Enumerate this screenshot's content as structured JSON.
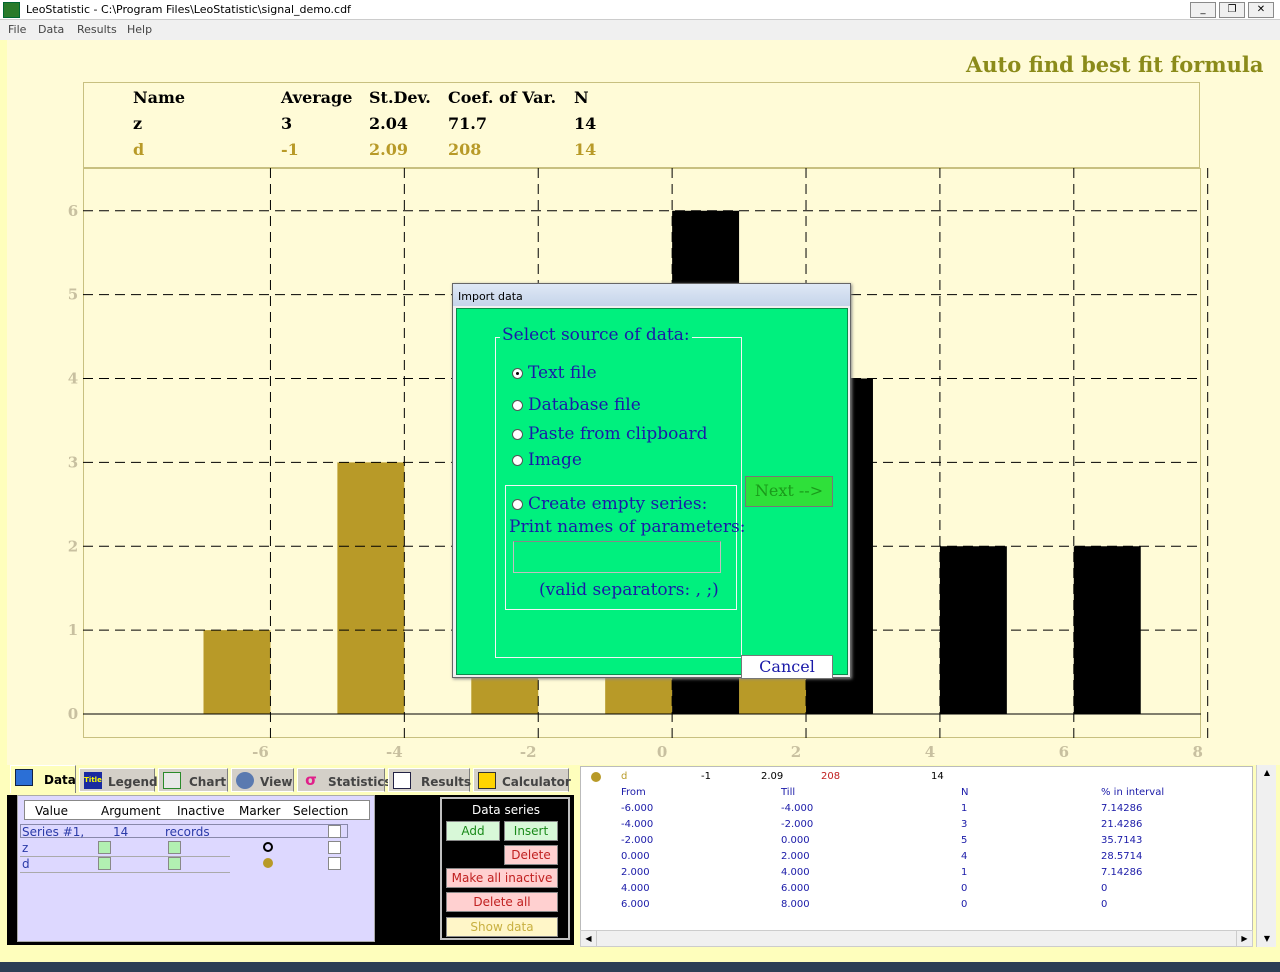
{
  "window": {
    "title": "LeoStatistic - C:\\Program Files\\LeoStatistic\\signal_demo.cdf",
    "minimize": "_",
    "restore": "❐",
    "close": "✕"
  },
  "menu": [
    "File",
    "Data",
    "Results",
    "Help"
  ],
  "fit_link": "Auto find best fit formula",
  "stats_table": {
    "headers": [
      "Name",
      "Average",
      "St.Dev.",
      "Coef. of Var.",
      "N"
    ],
    "rows": [
      {
        "name": "z",
        "average": "3",
        "stdev": "2.04",
        "coef": "71.7",
        "n": "14",
        "color": "#000000"
      },
      {
        "name": "d",
        "average": "-1",
        "stdev": "2.09",
        "coef": "208",
        "n": "14",
        "color": "#b89a28"
      }
    ]
  },
  "chart_data": {
    "type": "bar",
    "xlim": [
      -7.8,
      8.9
    ],
    "ylim": [
      0,
      6.2
    ],
    "x_ticks": [
      "-6",
      "-4",
      "-2",
      "0",
      "2",
      "4",
      "6",
      "8"
    ],
    "y_ticks": [
      "0",
      "1",
      "2",
      "3",
      "4",
      "5",
      "6"
    ],
    "grid": true,
    "series": [
      {
        "name": "d",
        "color": "#b89a28",
        "bins": [
          [
            -6,
            -4
          ],
          [
            -4,
            -2
          ],
          [
            -2,
            0
          ],
          [
            0,
            2
          ],
          [
            2,
            4
          ],
          [
            4,
            6
          ],
          [
            6,
            8
          ]
        ],
        "values": [
          1,
          3,
          5,
          4,
          1,
          0,
          0
        ]
      },
      {
        "name": "z",
        "color": "#000000",
        "bins": [
          [
            -6,
            -4
          ],
          [
            -4,
            -2
          ],
          [
            -2,
            0
          ],
          [
            0,
            2
          ],
          [
            2,
            4
          ],
          [
            4,
            6
          ],
          [
            6,
            8
          ]
        ],
        "values": [
          0,
          0,
          0,
          6,
          4,
          2,
          2
        ]
      }
    ]
  },
  "dialog": {
    "title": "Import data",
    "group_label": "Select source of data:",
    "options": [
      "Text file",
      "Database file",
      "Paste from clipboard",
      "Image"
    ],
    "selected": "Text file",
    "create_empty": "Create empty series:",
    "print_names": "Print names of parameters:",
    "param_value": "",
    "separators": "(valid separators: , ;)",
    "next": "Next -->",
    "cancel": "Cancel"
  },
  "tabs": [
    "Data",
    "Legend",
    "Chart",
    "View",
    "Statistics",
    "Results",
    "Calculator"
  ],
  "tab_title_icon": "Title",
  "active_tab": "Data",
  "data_grid": {
    "headers": [
      "Value",
      "Argument",
      "Inactive",
      "Marker",
      "Selection"
    ],
    "series_row": {
      "label": "Series #1,",
      "count": "14",
      "unit": "records"
    },
    "rows": [
      {
        "name": "z",
        "marker": "circle-outline",
        "marker_color": "#000000"
      },
      {
        "name": "d",
        "marker": "circle-filled",
        "marker_color": "#b89a28"
      }
    ]
  },
  "series_panel": {
    "label": "Data series",
    "add": "Add",
    "insert": "Insert",
    "delete": "Delete",
    "make_inactive": "Make all inactive",
    "delete_all": "Delete all",
    "show_data": "Show data"
  },
  "results": {
    "summary": {
      "name": "d",
      "average": "-1",
      "stdev": "2.09",
      "coef": "208",
      "n": "14"
    },
    "headers": [
      "From",
      "Till",
      "N",
      "% in interval"
    ],
    "rows": [
      [
        "-6.000",
        "-4.000",
        "1",
        "7.14286"
      ],
      [
        "-4.000",
        "-2.000",
        "3",
        "21.4286"
      ],
      [
        "-2.000",
        "0.000",
        "5",
        "35.7143"
      ],
      [
        "0.000",
        "2.000",
        "4",
        "28.5714"
      ],
      [
        "2.000",
        "4.000",
        "1",
        "7.14286"
      ],
      [
        "4.000",
        "6.000",
        "0",
        "0"
      ],
      [
        "6.000",
        "8.000",
        "0",
        "0"
      ]
    ]
  },
  "colors": {
    "accent_green": "#00f07e",
    "chart_bg": "#fffbd7",
    "link": "#8b8b1a",
    "text_blue": "#1a1aa8"
  }
}
